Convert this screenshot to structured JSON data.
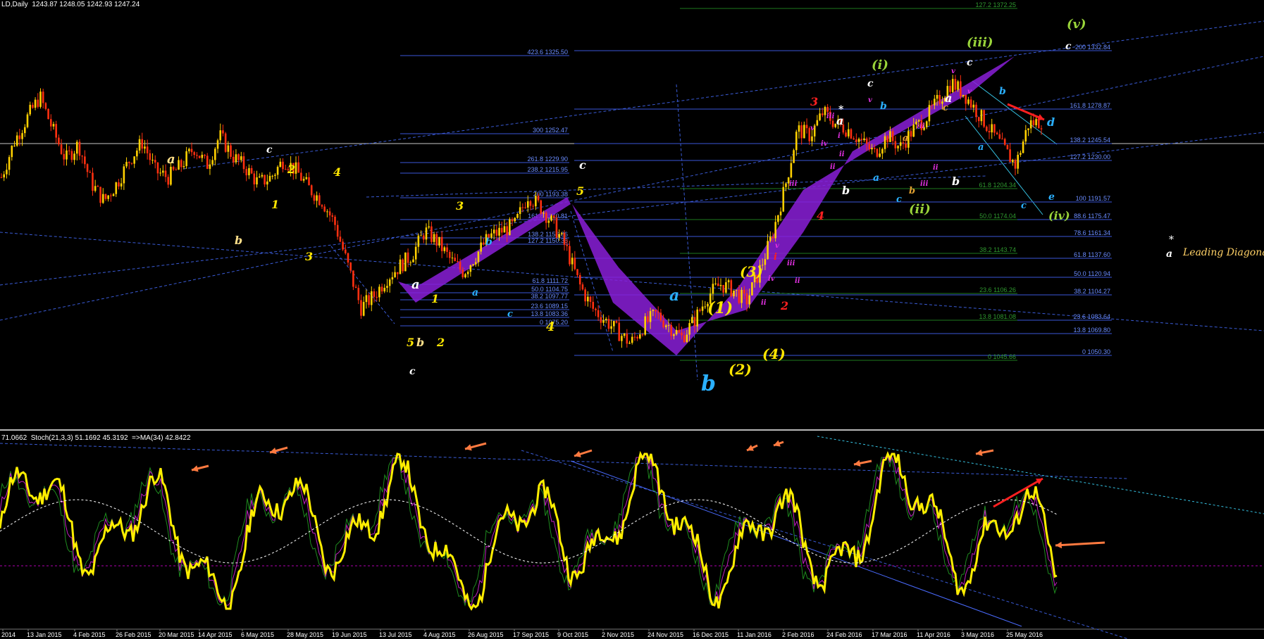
{
  "header": {
    "symbol_line": "LD,Daily  1243.87 1248.05 1242.93 1247.24",
    "indicator_line": "71.0662  Stoch(21,3,3) 51.1692 45.3192  =>MA(34) 42.8422"
  },
  "legend": {
    "star": "*",
    "a_label": "a",
    "text": "Leading Diagonal"
  },
  "chart_data": {
    "type": "candlestick",
    "price_axis_note": "price panel with fibonacci levels",
    "x_tick_labels": [
      "2014",
      "13 Jan 2015",
      "4 Feb 2015",
      "26 Feb 2015",
      "20 Mar 2015",
      "14 Apr 2015",
      "6 May 2015",
      "28 May 2015",
      "19 Jun 2015",
      "13 Jul 2015",
      "4 Aug 2015",
      "26 Aug 2015",
      "17 Sep 2015",
      "9 Oct 2015",
      "2 Nov 2015",
      "24 Nov 2015",
      "16 Dec 2015",
      "11 Jan 2016",
      "2 Feb 2016",
      "24 Feb 2016",
      "17 Mar 2016",
      "11 Apr 2016",
      "3 May 2016",
      "25 May 2016"
    ],
    "close_path": [
      1200,
      1230,
      1250,
      1268,
      1240,
      1215,
      1228,
      1195,
      1180,
      1195,
      1215,
      1230,
      1205,
      1200,
      1210,
      1225,
      1210,
      1235,
      1218,
      1208,
      1195,
      1200,
      1215,
      1205,
      1190,
      1180,
      1160,
      1125,
      1090,
      1100,
      1115,
      1125,
      1135,
      1155,
      1145,
      1130,
      1120,
      1135,
      1150,
      1155,
      1160,
      1185,
      1175,
      1160,
      1140,
      1110,
      1090,
      1080,
      1070,
      1060,
      1075,
      1085,
      1075,
      1065,
      1080,
      1100,
      1110,
      1105,
      1095,
      1120,
      1150,
      1190,
      1240,
      1235,
      1255,
      1245,
      1240,
      1230,
      1220,
      1235,
      1225,
      1240,
      1250,
      1265,
      1280,
      1270,
      1255,
      1240,
      1225,
      1210,
      1245,
      1247
    ],
    "fib_left": [
      {
        "label": "423.6 1325.50",
        "price": 1325.5
      },
      {
        "label": "300 1252.47",
        "price": 1252.47
      },
      {
        "label": "261.8 1229.90",
        "price": 1229.9
      },
      {
        "label": "238.2 1215.95",
        "price": 1215.95
      },
      {
        "label": "200 1193.38",
        "price": 1193.38
      },
      {
        "label": "161.8 1170.81",
        "price": 1170.81
      },
      {
        "label": "138.2 1156.86",
        "price": 1156.86
      },
      {
        "label": "127.2 1150.36",
        "price": 1150.36
      },
      {
        "label": "61.8 1111.72",
        "price": 1111.72
      },
      {
        "label": "50.0 1104.75",
        "price": 1104.75
      },
      {
        "label": "38.2 1097.77",
        "price": 1097.77
      },
      {
        "label": "23.6 1089.15",
        "price": 1089.15
      },
      {
        "label": "13.8 1083.36",
        "price": 1083.36
      },
      {
        "label": "0 1075.20",
        "price": 1075.2
      }
    ],
    "fib_right": [
      {
        "label": "200 1332.84",
        "price": 1332.84
      },
      {
        "label": "161.8 1278.87",
        "price": 1278.87
      },
      {
        "label": "138.2 1245.54",
        "price": 1245.54
      },
      {
        "label": "127.2 1230.00",
        "price": 1230.0
      },
      {
        "label": "100 1191.57",
        "price": 1191.57
      },
      {
        "label": "88.6 1175.47",
        "price": 1175.47
      },
      {
        "label": "78.6 1161.34",
        "price": 1161.34
      },
      {
        "label": "61.8 1137.60",
        "price": 1137.6
      },
      {
        "label": "50.0 1120.94",
        "price": 1120.94
      },
      {
        "label": "38.2 1104.27",
        "price": 1104.27
      },
      {
        "label": "23.6 1083.64",
        "price": 1083.64
      },
      {
        "label": "13.8 1069.80",
        "price": 1069.8
      },
      {
        "label": "0 1050.30",
        "price": 1050.3
      }
    ],
    "fib_green": [
      {
        "label": "127.2 1372.25",
        "price": 1372.25
      },
      {
        "label": "61.8 1204.34",
        "price": 1204.34
      },
      {
        "label": "50.0 1174.04",
        "price": 1174.04
      },
      {
        "label": "38.2 1143.74",
        "price": 1143.74
      },
      {
        "label": "23.6 1106.26",
        "price": 1106.26
      },
      {
        "label": "13.8 1081.08",
        "price": 1081.08
      },
      {
        "label": "0 1045.66",
        "price": 1045.66
      }
    ],
    "current_price": 1247.24,
    "stoch_note": "Stoch(21,3,3) with MA(34)"
  },
  "wave_labels": [
    {
      "t": "a",
      "c": "#ffe08a"
    },
    {
      "t": "b",
      "c": "#ffe08a"
    },
    {
      "t": "c",
      "c": "#ffffff"
    },
    {
      "t": "2",
      "c": "#ffe600"
    },
    {
      "t": "1",
      "c": "#ffe600"
    },
    {
      "t": "3",
      "c": "#ffe600"
    },
    {
      "t": "4",
      "c": "#ffe600"
    },
    {
      "t": "3",
      "c": "#ffe600"
    },
    {
      "t": "a",
      "c": "#ffffff"
    },
    {
      "t": "1",
      "c": "#ffe600"
    },
    {
      "t": "b",
      "c": "#2ab0ff"
    },
    {
      "t": "a",
      "c": "#2ab0ff"
    },
    {
      "t": "c",
      "c": "#2ab0ff"
    },
    {
      "t": "5",
      "c": "#ffe600"
    },
    {
      "t": "b",
      "c": "#ffe08a"
    },
    {
      "t": "2",
      "c": "#ffe600"
    },
    {
      "t": "c",
      "c": "#ffffff"
    },
    {
      "t": "4",
      "c": "#ffe600"
    },
    {
      "t": "c",
      "c": "#ffffff"
    },
    {
      "t": "5",
      "c": "#ffe600"
    },
    {
      "t": "a",
      "c": "#2ab0ff"
    },
    {
      "t": "b",
      "c": "#2ab0ff"
    },
    {
      "t": "(1)",
      "c": "#ffe600"
    },
    {
      "t": "(2)",
      "c": "#ffe600"
    },
    {
      "t": "(3)",
      "c": "#ffe600"
    },
    {
      "t": "(4)",
      "c": "#ffe600"
    },
    {
      "t": "(i)",
      "c": "#9ad53a"
    },
    {
      "t": "(ii)",
      "c": "#9ad53a"
    },
    {
      "t": "(iii)",
      "c": "#9ad53a"
    },
    {
      "t": "(iv)",
      "c": "#9ad53a"
    },
    {
      "t": "(v)",
      "c": "#9ad53a"
    },
    {
      "t": "c",
      "c": "#ffffff"
    },
    {
      "t": "c",
      "c": "#ffffff"
    },
    {
      "t": "c",
      "c": "#ffffff"
    },
    {
      "t": "3",
      "c": "#ff2020"
    },
    {
      "t": "4",
      "c": "#ff2020"
    },
    {
      "t": "2",
      "c": "#ff2020"
    },
    {
      "t": "i",
      "c": "#ff2020"
    },
    {
      "t": "a",
      "c": "#ffffff"
    },
    {
      "t": "b",
      "c": "#ffffff"
    },
    {
      "t": "b",
      "c": "#ffffff"
    },
    {
      "t": "a",
      "c": "#ffffff"
    },
    {
      "t": "a",
      "c": "#2ab0ff"
    },
    {
      "t": "b",
      "c": "#2ab0ff"
    },
    {
      "t": "c",
      "c": "#2ab0ff"
    },
    {
      "t": "d",
      "c": "#2ab0ff"
    },
    {
      "t": "e",
      "c": "#2ab0ff"
    },
    {
      "t": "a",
      "c": "#2ab0ff"
    },
    {
      "t": "b",
      "c": "#2ab0ff"
    },
    {
      "t": "c",
      "c": "#2ab0ff"
    },
    {
      "t": "a",
      "c": "#e0a030"
    },
    {
      "t": "b",
      "c": "#e0a030"
    },
    {
      "t": "c",
      "c": "#e0a030"
    },
    {
      "t": "*",
      "c": "#ffffff"
    }
  ]
}
